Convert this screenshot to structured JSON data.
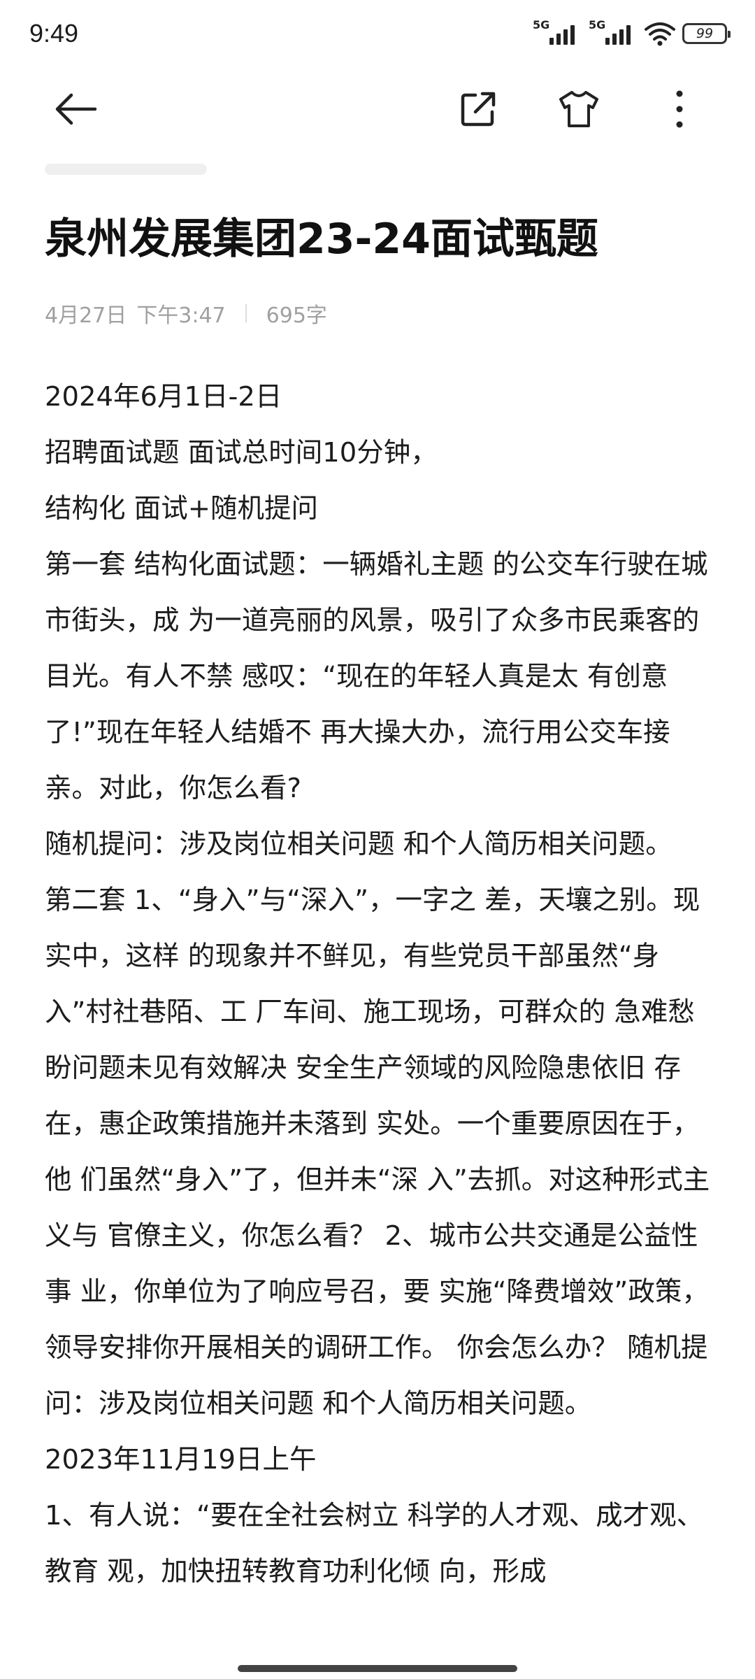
{
  "status_bar": {
    "time": "9:49",
    "sim1_network": "5G",
    "sim2_network": "5G",
    "battery_level": "99"
  },
  "toolbar": {
    "back_icon": "arrow-left-icon",
    "share_icon": "share-external-icon",
    "theme_icon": "tshirt-icon",
    "more_icon": "more-vertical-icon"
  },
  "note": {
    "title": "泉州发展集团23-24面试甄题",
    "date": "4月27日",
    "time": "下午3:47",
    "word_count": "695字",
    "paragraphs": [
      "2024年6月1日-2日",
      "招聘面试题 面试总时间10分钟，",
      "结构化 面试+随机提问",
      "第一套 结构化面试题：一辆婚礼主题 的公交车行驶在城市街头，成 为一道亮丽的风景，吸引了众多市民乘客的目光。有人不禁 感叹：“现在的年轻人真是太 有创意了!”现在年轻人结婚不 再大操大办，流行用公交车接 亲。对此，你怎么看?",
      "随机提问：涉及岗位相关问题 和个人简历相关问题。",
      "第二套 1、“身入”与“深入”，一字之 差，天壤之别。现实中，这样 的现象并不鲜见，有些党员干部虽然“身入”村社巷陌、工 厂车间、施工现场，可群众的 急难愁盼问题未见有效解决 安全生产领域的风险隐患依旧 存在，惠企政策措施并未落到 实处。一个重要原因在于，他 们虽然“身入”了，但并未“深 入”去抓。对这种形式主义与 官僚主义，你怎么看？ 2、城市公共交通是公益性事 业，你单位为了响应号召，要 实施“降费增效”政策，领导安排你开展相关的调研工作。 你会怎么办？ 随机提问：涉及岗位相关问题 和个人简历相关问题。",
      "2023年11月19日上午",
      "1、有人说：“要在全社会树立 科学的人才观、成才观、教育 观，加快扭转教育功利化倾 向，形成"
    ]
  }
}
